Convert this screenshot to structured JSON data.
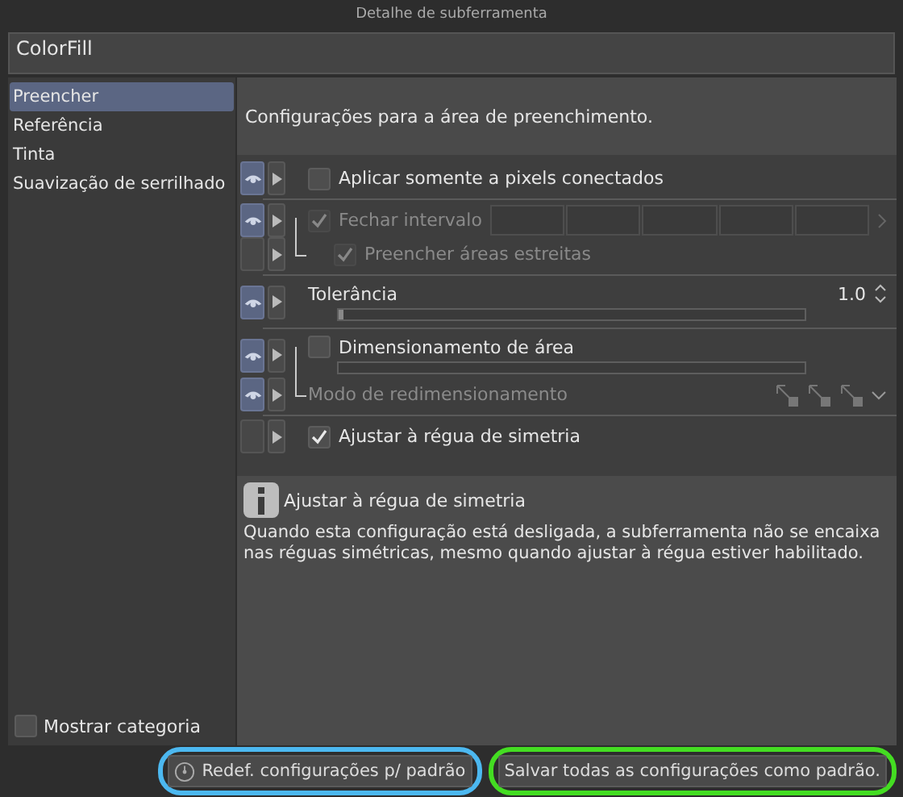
{
  "window": {
    "title": "Detalhe de subferramenta"
  },
  "tool_name": "ColorFill",
  "sidebar": {
    "items": [
      {
        "label": "Preencher",
        "selected": true
      },
      {
        "label": "Referência",
        "selected": false
      },
      {
        "label": "Tinta",
        "selected": false
      },
      {
        "label": "Suavização de serrilhado",
        "selected": false
      }
    ],
    "show_category": {
      "label": "Mostrar categoria",
      "checked": false
    }
  },
  "panel": {
    "heading": "Configurações para a área de preenchimento.",
    "groups": [
      {
        "rows": [
          {
            "kind": "checkbox",
            "eye": true,
            "label": "Aplicar somente a pixels conectados",
            "checked": false,
            "disabled": false
          }
        ]
      },
      {
        "rows": [
          {
            "kind": "interval",
            "eye": true,
            "label": "Fechar intervalo",
            "checked": true,
            "disabled": true,
            "children": [
              {
                "kind": "checkbox",
                "eye": false,
                "label": "Preencher áreas estreitas",
                "checked": true,
                "disabled": true
              }
            ]
          }
        ]
      },
      {
        "rows": [
          {
            "kind": "slider",
            "eye": true,
            "label": "Tolerância",
            "level": 0.01,
            "value": "1.0"
          }
        ]
      },
      {
        "rows": [
          {
            "kind": "checkbar",
            "eye": true,
            "label": "Dimensionamento de área",
            "checked": false,
            "disabled": false,
            "children": [
              {
                "kind": "mode",
                "eye": true,
                "label": "Modo de redimensionamento",
                "disabled": true
              }
            ]
          }
        ]
      },
      {
        "rows": [
          {
            "kind": "checkbox",
            "eye": false,
            "label": "Ajustar à régua de simetria",
            "checked": true,
            "disabled": false
          }
        ]
      }
    ]
  },
  "info": {
    "title": "Ajustar à régua de simetria",
    "text": "Quando esta configuração está desligada, a subferramenta não se encaixa nas réguas simétricas, mesmo quando ajustar à régua estiver habilitado."
  },
  "buttons": [
    {
      "label": "Redef. configurações p/ padrão",
      "kind": "reset",
      "color": "#4cb8f0"
    },
    {
      "label": "Salvar todas as configurações como padrão.",
      "kind": "save",
      "color": "#44dd22"
    }
  ]
}
